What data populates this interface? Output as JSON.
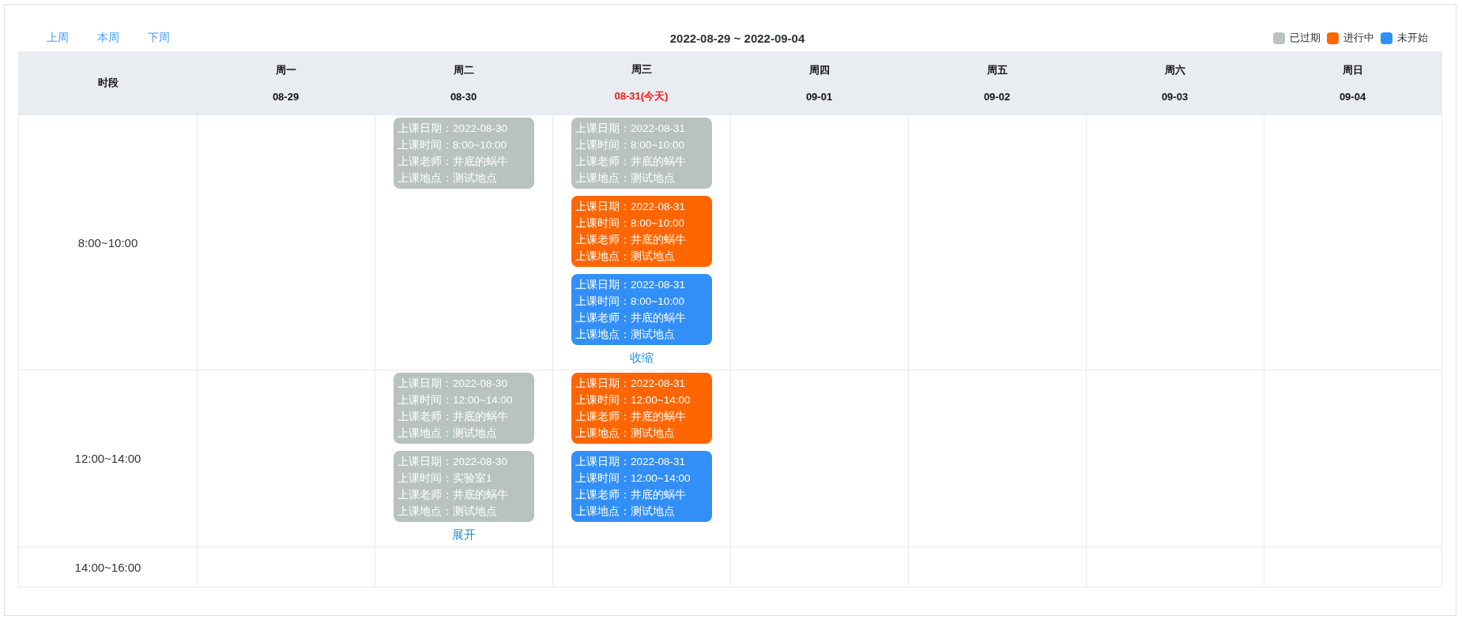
{
  "nav": [
    {
      "label": "上周"
    },
    {
      "label": "本周"
    },
    {
      "label": "下周"
    }
  ],
  "range": "2022-08-29 ~ 2022-09-04",
  "legend": [
    {
      "label": "已过期",
      "color": "#b7c2c1"
    },
    {
      "label": "进行中",
      "color": "#ff6600"
    },
    {
      "label": "未开始",
      "color": "#328ff8"
    }
  ],
  "header": {
    "slot_label": "时段",
    "days": [
      {
        "weekday": "周一",
        "date": "08-29",
        "today": false
      },
      {
        "weekday": "周二",
        "date": "08-30",
        "today": false
      },
      {
        "weekday": "周三",
        "date": "08-31(今天)",
        "today": true
      },
      {
        "weekday": "周四",
        "date": "09-01",
        "today": false
      },
      {
        "weekday": "周五",
        "date": "09-02",
        "today": false
      },
      {
        "weekday": "周六",
        "date": "09-03",
        "today": false
      },
      {
        "weekday": "周日",
        "date": "09-04",
        "today": false
      }
    ]
  },
  "rows": [
    {
      "slot": "8:00~10:00",
      "cells": [
        {},
        {
          "cards": [
            {
              "color": "#b7c2c1",
              "lines": [
                "上课日期：2022-08-30",
                "上课时间：8:00~10:00",
                "上课老师：井底的蜗牛",
                "上课地点：测试地点"
              ]
            }
          ]
        },
        {
          "cards": [
            {
              "color": "#b7c2c1",
              "lines": [
                "上课日期：2022-08-31",
                "上课时间：8:00~10:00",
                "上课老师：井底的蜗牛",
                "上课地点：测试地点"
              ]
            },
            {
              "color": "#ff6600",
              "lines": [
                "上课日期：2022-08-31",
                "上课时间：8:00~10:00",
                "上课老师：井底的蜗牛",
                "上课地点：测试地点"
              ]
            },
            {
              "color": "#328ff8",
              "lines": [
                "上课日期：2022-08-31",
                "上课时间：8:00~10:00",
                "上课老师：井底的蜗牛",
                "上课地点：测试地点"
              ]
            }
          ],
          "toggle": "收缩"
        },
        {},
        {},
        {},
        {}
      ]
    },
    {
      "slot": "12:00~14:00",
      "cells": [
        {},
        {
          "cards": [
            {
              "color": "#b7c2c1",
              "lines": [
                "上课日期：2022-08-30",
                "上课时间：12:00~14:00",
                "上课老师：井底的蜗牛",
                "上课地点：测试地点"
              ]
            },
            {
              "color": "#b7c2c1",
              "lines": [
                "上课日期：2022-08-30",
                "上课时间：实验室1",
                "上课老师：井底的蜗牛",
                "上课地点：测试地点"
              ]
            }
          ],
          "toggle": "展开"
        },
        {
          "cards": [
            {
              "color": "#ff6600",
              "lines": [
                "上课日期：2022-08-31",
                "上课时间：12:00~14:00",
                "上课老师：井底的蜗牛",
                "上课地点：测试地点"
              ]
            },
            {
              "color": "#328ff8",
              "lines": [
                "上课日期：2022-08-31",
                "上课时间：12:00~14:00",
                "上课老师：井底的蜗牛",
                "上课地点：测试地点"
              ]
            }
          ]
        },
        {},
        {},
        {},
        {}
      ]
    },
    {
      "slot": "14:00~16:00",
      "cells": [
        {},
        {},
        {},
        {},
        {},
        {},
        {}
      ]
    }
  ]
}
